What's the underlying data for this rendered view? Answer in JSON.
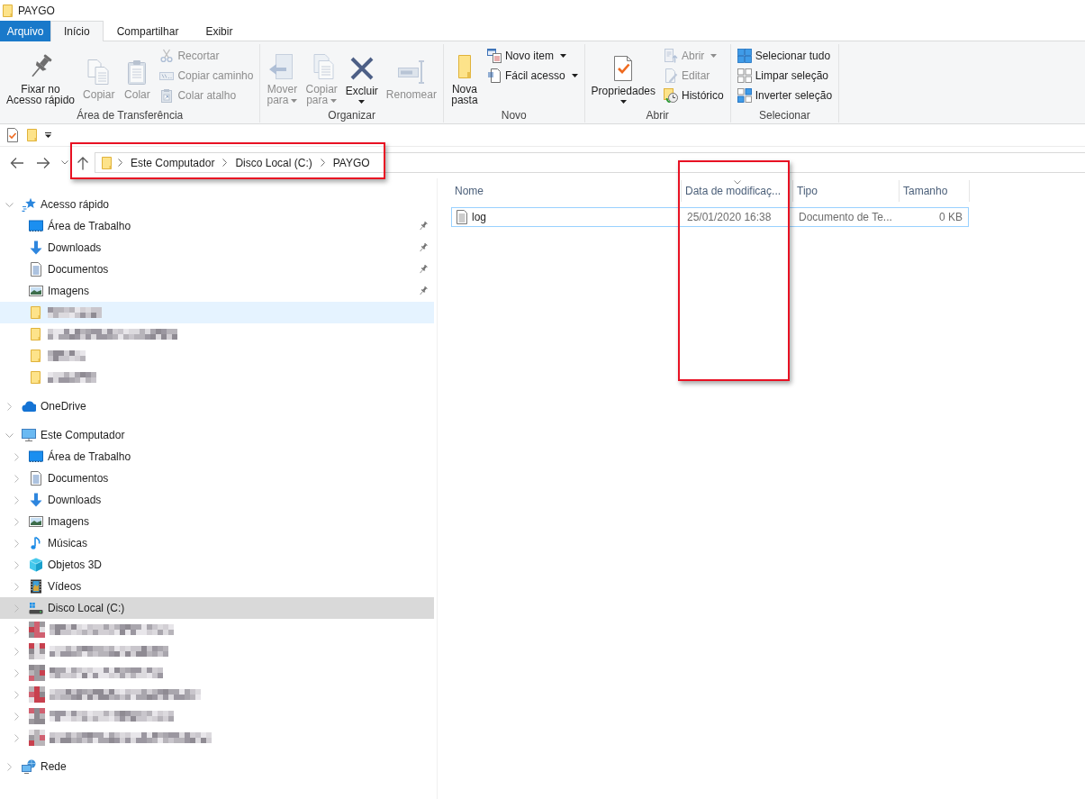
{
  "window": {
    "title": "PAYGO"
  },
  "ribbon": {
    "tabs": [
      {
        "label": "Arquivo",
        "kind": "file",
        "selected": false
      },
      {
        "label": "Início",
        "kind": "tab",
        "selected": true
      },
      {
        "label": "Compartilhar",
        "kind": "tab",
        "selected": false
      },
      {
        "label": "Exibir",
        "kind": "tab",
        "selected": false
      }
    ],
    "groups": [
      {
        "label": "Área de Transferência",
        "large_buttons": [
          {
            "kind": "pin",
            "label": "Fixar no\nAcesso rápido",
            "disabled": false,
            "dropdown": false
          },
          {
            "kind": "copy",
            "label": "Copiar",
            "disabled": true,
            "dropdown": false
          },
          {
            "kind": "paste",
            "label": "Colar",
            "disabled": true,
            "dropdown": false
          }
        ],
        "small_buttons": [
          {
            "kind": "cut",
            "label": "Recortar",
            "disabled": true,
            "dropdown": false
          },
          {
            "kind": "copy-path",
            "label": "Copiar caminho",
            "disabled": true,
            "dropdown": false
          },
          {
            "kind": "paste-shortcut",
            "label": "Colar atalho",
            "disabled": true,
            "dropdown": false
          }
        ]
      },
      {
        "label": "Organizar",
        "large_buttons": [
          {
            "kind": "move-to",
            "label": "Mover\npara",
            "disabled": true,
            "dropdown": true
          },
          {
            "kind": "copy-to",
            "label": "Copiar\npara",
            "disabled": true,
            "dropdown": true
          },
          {
            "kind": "delete",
            "label": "Excluir",
            "disabled": false,
            "dropdown": true
          },
          {
            "kind": "rename",
            "label": "Renomear",
            "disabled": true,
            "dropdown": false
          }
        ]
      },
      {
        "label": "Novo",
        "large_buttons": [
          {
            "kind": "new-folder",
            "label": "Nova\npasta",
            "disabled": false,
            "dropdown": false
          }
        ],
        "small_buttons": [
          {
            "kind": "new-item",
            "label": "Novo item",
            "disabled": false,
            "dropdown": true
          },
          {
            "kind": "easy-access",
            "label": "Fácil acesso",
            "disabled": false,
            "dropdown": true
          }
        ]
      },
      {
        "label": "Abrir",
        "large_buttons": [
          {
            "kind": "properties",
            "label": "Propriedades",
            "disabled": false,
            "dropdown": true
          }
        ],
        "small_buttons": [
          {
            "kind": "open",
            "label": "Abrir",
            "disabled": true,
            "dropdown": true
          },
          {
            "kind": "edit",
            "label": "Editar",
            "disabled": true,
            "dropdown": false
          },
          {
            "kind": "history",
            "label": "Histórico",
            "disabled": false,
            "dropdown": false
          }
        ]
      },
      {
        "label": "Selecionar",
        "small_buttons": [
          {
            "kind": "select-all",
            "label": "Selecionar tudo",
            "disabled": false,
            "dropdown": false
          },
          {
            "kind": "select-none",
            "label": "Limpar seleção",
            "disabled": false,
            "dropdown": false
          },
          {
            "kind": "invert-selection",
            "label": "Inverter seleção",
            "disabled": false,
            "dropdown": false
          }
        ]
      }
    ]
  },
  "address_bar": {
    "crumbs": [
      "Este Computador",
      "Disco Local (C:)",
      "PAYGO"
    ],
    "highlighted": true
  },
  "sidebar": {
    "items": [
      {
        "kind": "star",
        "label": "Acesso rápido",
        "expanded": true,
        "selected": false,
        "hovered": false,
        "children": [
          {
            "kind": "desktop",
            "label": "Área de Trabalho",
            "pinned": true,
            "selected": false,
            "hovered": false
          },
          {
            "kind": "downloads",
            "label": "Downloads",
            "pinned": true,
            "selected": false,
            "hovered": false
          },
          {
            "kind": "documents",
            "label": "Documentos",
            "pinned": true,
            "selected": false,
            "hovered": false
          },
          {
            "kind": "pictures",
            "label": "Imagens",
            "pinned": true,
            "selected": false,
            "hovered": false
          },
          {
            "kind": "redacted-folder",
            "pinned": false,
            "selected": false,
            "hovered": true
          },
          {
            "kind": "redacted-folder",
            "pinned": false,
            "selected": false,
            "hovered": false
          },
          {
            "kind": "redacted-folder",
            "pinned": false,
            "selected": false,
            "hovered": false
          },
          {
            "kind": "redacted-folder",
            "pinned": false,
            "selected": false,
            "hovered": false
          }
        ]
      },
      {
        "kind": "cloud",
        "label": "OneDrive",
        "expanded": false,
        "selected": false,
        "hovered": false
      },
      {
        "kind": "computer",
        "label": "Este Computador",
        "expanded": true,
        "selected": false,
        "hovered": false,
        "children": [
          {
            "kind": "desktop",
            "label": "Área de Trabalho",
            "expanded": false,
            "selected": false,
            "hovered": false
          },
          {
            "kind": "documents",
            "label": "Documentos",
            "expanded": false,
            "selected": false,
            "hovered": false
          },
          {
            "kind": "downloads",
            "label": "Downloads",
            "expanded": false,
            "selected": false,
            "hovered": false
          },
          {
            "kind": "pictures",
            "label": "Imagens",
            "expanded": false,
            "selected": false,
            "hovered": false
          },
          {
            "kind": "music",
            "label": "Músicas",
            "expanded": false,
            "selected": false,
            "hovered": false
          },
          {
            "kind": "objects3d",
            "label": "Objetos 3D",
            "expanded": false,
            "selected": false,
            "hovered": false
          },
          {
            "kind": "videos",
            "label": "Vídeos",
            "expanded": false,
            "selected": false,
            "hovered": false
          },
          {
            "kind": "drive",
            "label": "Disco Local (C:)",
            "expanded": false,
            "selected": true,
            "hovered": false
          },
          {
            "kind": "redacted-drive",
            "expanded": false,
            "selected": false,
            "hovered": false
          },
          {
            "kind": "redacted-drive",
            "expanded": false,
            "selected": false,
            "hovered": false
          },
          {
            "kind": "redacted-drive",
            "expanded": false,
            "selected": false,
            "hovered": false
          },
          {
            "kind": "redacted-drive",
            "expanded": false,
            "selected": false,
            "hovered": false
          },
          {
            "kind": "redacted-drive",
            "expanded": false,
            "selected": false,
            "hovered": false
          },
          {
            "kind": "redacted-drive",
            "expanded": false,
            "selected": false,
            "hovered": false
          }
        ]
      },
      {
        "kind": "network",
        "label": "Rede",
        "expanded": false,
        "selected": false,
        "hovered": false
      }
    ]
  },
  "file_list": {
    "columns": [
      {
        "label": "Nome",
        "sorted": false,
        "highlighted": false
      },
      {
        "label": "Data de modificaç...",
        "sorted": true,
        "highlighted": true
      },
      {
        "label": "Tipo",
        "sorted": false,
        "highlighted": false
      },
      {
        "label": "Tamanho",
        "sorted": false,
        "highlighted": false
      }
    ],
    "rows": [
      {
        "kind": "text-document",
        "cells": [
          "log",
          "25/01/2020 16:38",
          "Documento de Te...",
          "0 KB"
        ],
        "focused": true,
        "selected": false
      }
    ]
  }
}
